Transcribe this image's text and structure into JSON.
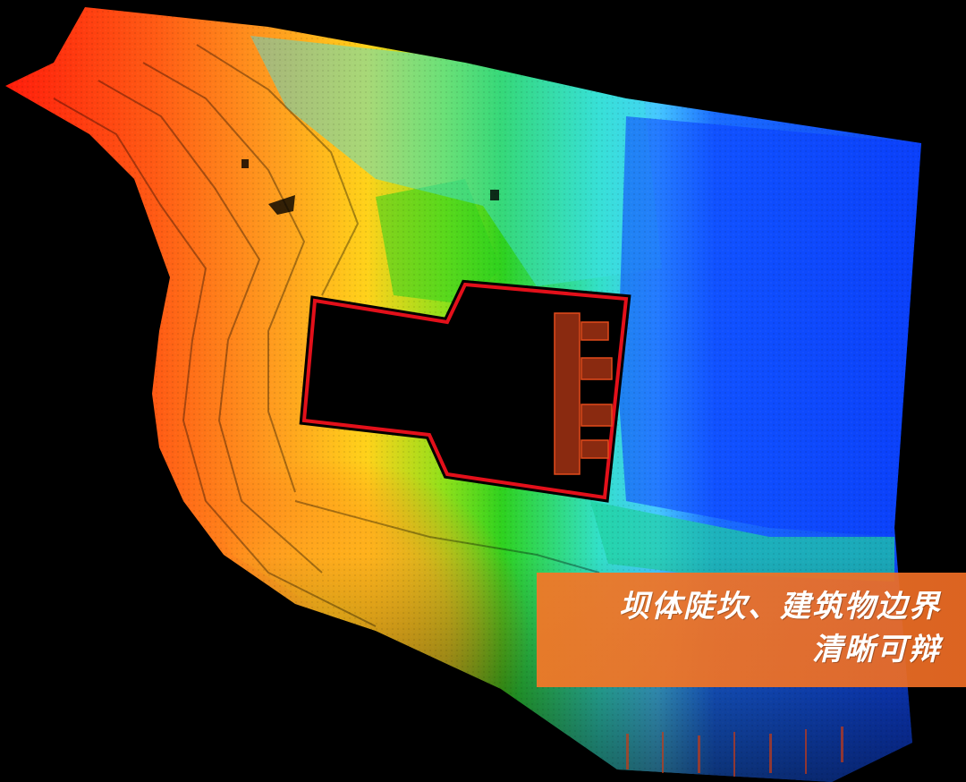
{
  "scene": {
    "subject": "point-cloud-elevation-render",
    "colors": {
      "background": "#000000",
      "high": "#ff1a0a",
      "mid_high": "#ff8a1c",
      "mid": "#ffe01a",
      "mid_low": "#2ed11e",
      "low": "#28d8e8",
      "lowest": "#0a3cff",
      "outline": "#e3101a"
    }
  },
  "caption": {
    "line1": "坝体陡坎、建筑物边界",
    "line2": "清晰可辩",
    "background_color": "#f07828"
  }
}
